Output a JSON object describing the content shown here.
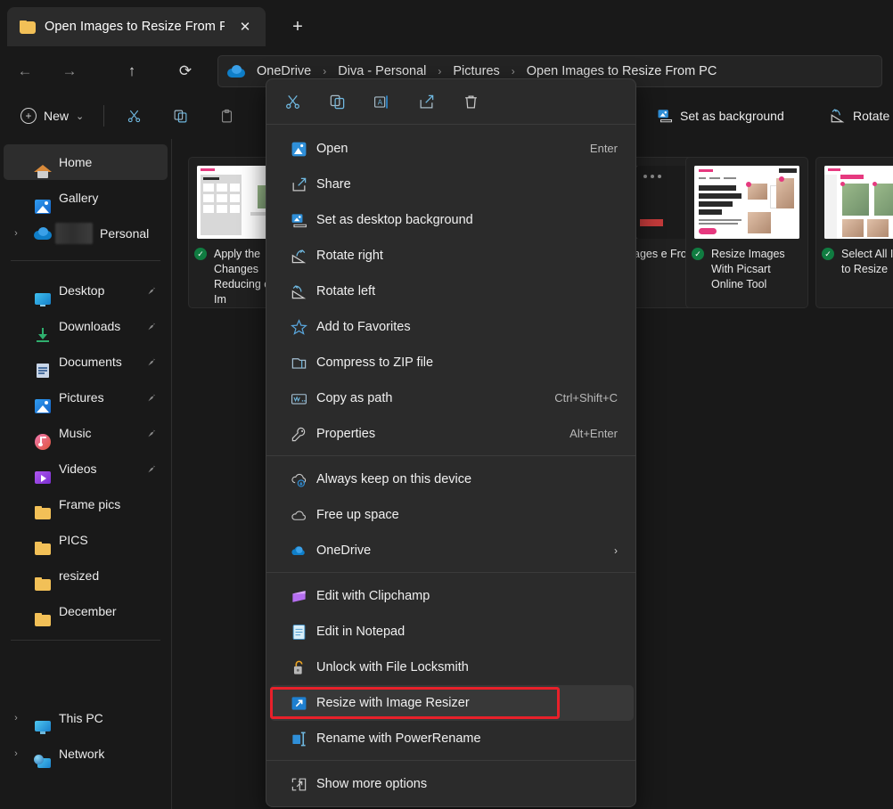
{
  "window": {
    "tab_title": "Open Images to Resize From P",
    "tab_close_glyph": "✕",
    "new_tab_glyph": "+"
  },
  "nav": {
    "back_glyph": "←",
    "forward_glyph": "→",
    "up_glyph": "↑",
    "refresh_glyph": "⟳"
  },
  "breadcrumb": {
    "sep": "›",
    "items": [
      {
        "label": "OneDrive"
      },
      {
        "label": "Diva - Personal"
      },
      {
        "label": "Pictures"
      },
      {
        "label": "Open Images to Resize From PC"
      }
    ]
  },
  "toolbar": {
    "new_label": "New",
    "new_plus": "+",
    "new_chevron": "⌄",
    "set_background_label": "Set as background",
    "rotate_label": "Rotate"
  },
  "sidebar": {
    "items": [
      {
        "label": "Home",
        "icon": "home-icon",
        "selected": true,
        "expandable": false,
        "pinned": false
      },
      {
        "label": "Gallery",
        "icon": "gallery-icon",
        "selected": false,
        "expandable": false,
        "pinned": false
      },
      {
        "label": "Personal",
        "icon": "onedrive-icon",
        "selected": false,
        "expandable": true,
        "pinned": false,
        "redacted": true
      },
      {
        "label": "Desktop",
        "icon": "desktop-icon",
        "selected": false,
        "expandable": false,
        "pinned": true
      },
      {
        "label": "Downloads",
        "icon": "download-icon",
        "selected": false,
        "expandable": false,
        "pinned": true
      },
      {
        "label": "Documents",
        "icon": "document-icon",
        "selected": false,
        "expandable": false,
        "pinned": true
      },
      {
        "label": "Pictures",
        "icon": "pictures-icon",
        "selected": false,
        "expandable": false,
        "pinned": true
      },
      {
        "label": "Music",
        "icon": "music-icon",
        "selected": false,
        "expandable": false,
        "pinned": true
      },
      {
        "label": "Videos",
        "icon": "video-icon",
        "selected": false,
        "expandable": false,
        "pinned": true
      },
      {
        "label": "Frame pics",
        "icon": "folder-icon",
        "selected": false,
        "expandable": false,
        "pinned": false
      },
      {
        "label": "PICS",
        "icon": "folder-icon",
        "selected": false,
        "expandable": false,
        "pinned": false
      },
      {
        "label": "resized",
        "icon": "folder-icon",
        "selected": false,
        "expandable": false,
        "pinned": false
      },
      {
        "label": "December",
        "icon": "folder-icon",
        "selected": false,
        "expandable": false,
        "pinned": false
      },
      {
        "label": "This PC",
        "icon": "thispc-icon",
        "selected": false,
        "expandable": true,
        "pinned": false
      },
      {
        "label": "Network",
        "icon": "network-icon",
        "selected": false,
        "expandable": true,
        "pinned": false
      }
    ],
    "pin_glyph": "📌",
    "chevron_glyph": "›"
  },
  "files": [
    {
      "name": "Apply the Changes Reducing of the Im",
      "sync": "✓",
      "thumb": "ui-panel"
    },
    {
      "name": "ages e From",
      "sync": "",
      "thumb": "dark-app"
    },
    {
      "name": "Resize Images With Picsart Online Tool",
      "sync": "✓",
      "thumb": "picsart-page"
    },
    {
      "name": "Select All Images to Resize",
      "sync": "✓",
      "thumb": "picsart-grid"
    }
  ],
  "context_menu": {
    "icon_row": [
      {
        "name": "cut-icon",
        "glyph": "cut"
      },
      {
        "name": "copy-icon",
        "glyph": "copy"
      },
      {
        "name": "rename-icon",
        "glyph": "rename"
      },
      {
        "name": "share-icon",
        "glyph": "share"
      },
      {
        "name": "delete-icon",
        "glyph": "delete"
      }
    ],
    "items": [
      {
        "label": "Open",
        "accel": "Enter",
        "icon": "open-image-icon",
        "sep_after": false
      },
      {
        "label": "Share",
        "accel": "",
        "icon": "share-icon",
        "sep_after": false
      },
      {
        "label": "Set as desktop background",
        "accel": "",
        "icon": "wallpaper-icon",
        "sep_after": false
      },
      {
        "label": "Rotate right",
        "accel": "",
        "icon": "rotate-right-icon",
        "sep_after": false
      },
      {
        "label": "Rotate left",
        "accel": "",
        "icon": "rotate-left-icon",
        "sep_after": false
      },
      {
        "label": "Add to Favorites",
        "accel": "",
        "icon": "star-icon",
        "sep_after": false
      },
      {
        "label": "Compress to ZIP file",
        "accel": "",
        "icon": "zip-icon",
        "sep_after": false
      },
      {
        "label": "Copy as path",
        "accel": "Ctrl+Shift+C",
        "icon": "copy-path-icon",
        "sep_after": false
      },
      {
        "label": "Properties",
        "accel": "Alt+Enter",
        "icon": "properties-icon",
        "sep_after": true
      },
      {
        "label": "Always keep on this device",
        "accel": "",
        "icon": "cloud-download-icon",
        "sep_after": false
      },
      {
        "label": "Free up space",
        "accel": "",
        "icon": "cloud-icon",
        "sep_after": false
      },
      {
        "label": "OneDrive",
        "accel": "",
        "icon": "onedrive-icon",
        "submenu": "›",
        "sep_after": true
      },
      {
        "label": "Edit with Clipchamp",
        "accel": "",
        "icon": "clipchamp-icon",
        "sep_after": false
      },
      {
        "label": "Edit in Notepad",
        "accel": "",
        "icon": "notepad-icon",
        "sep_after": false
      },
      {
        "label": "Unlock with File Locksmith",
        "accel": "",
        "icon": "lock-open-icon",
        "sep_after": false
      },
      {
        "label": "Resize with Image Resizer",
        "accel": "",
        "icon": "image-resizer-icon",
        "highlighted": true,
        "sep_after": false
      },
      {
        "label": "Rename with PowerRename",
        "accel": "",
        "icon": "powerrename-icon",
        "sep_after": true
      },
      {
        "label": "Show more options",
        "accel": "",
        "icon": "more-options-icon",
        "sep_after": false
      }
    ]
  },
  "annotation": {
    "color": "#e8202a",
    "target": "Resize with Image Resizer"
  }
}
